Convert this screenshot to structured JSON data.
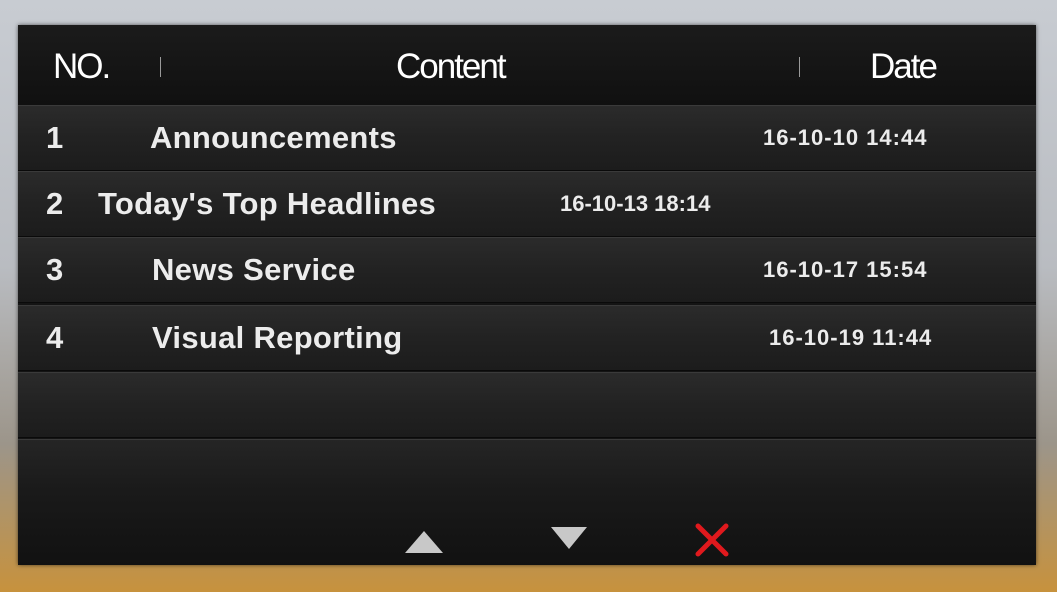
{
  "header": {
    "no_label": "NO.",
    "content_label": "Content",
    "date_label": "Date"
  },
  "rows": [
    {
      "no": "1",
      "content": "Announcements",
      "date": "16-10-10  14:44"
    },
    {
      "no": "2",
      "content": "Today's Top Headlines",
      "date": "16-10-13  18:14"
    },
    {
      "no": "3",
      "content": "News Service",
      "date": "16-10-17  15:54"
    },
    {
      "no": "4",
      "content": "Visual Reporting",
      "date": "16-10-19  11:44"
    }
  ],
  "controls": {
    "up_icon": "triangle-up",
    "down_icon": "triangle-down",
    "delete_icon": "red-x",
    "delete_color": "#e0191d",
    "arrow_color": "#c8c8c8"
  }
}
